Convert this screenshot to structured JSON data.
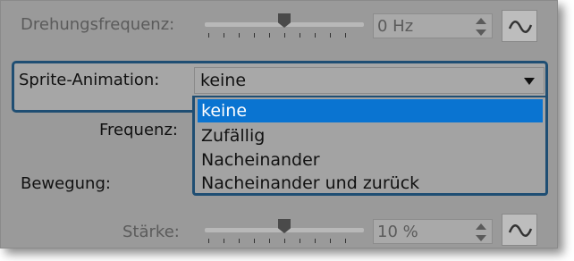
{
  "rotation": {
    "label": "Drehungsfrequenz:",
    "value": "0 Hz",
    "slider_fraction": 0.5
  },
  "sprite_animation": {
    "label": "Sprite-Animation:",
    "selected": "keine",
    "options": [
      "keine",
      "Zufällig",
      "Nacheinander",
      "Nacheinander und zurück"
    ]
  },
  "frequency": {
    "label": "Frequenz:"
  },
  "movement": {
    "label": "Bewegung:"
  },
  "strength": {
    "label": "Stärke:",
    "value": "10 %",
    "slider_fraction": 0.5
  },
  "colors": {
    "panel": "#9a9a9a",
    "focus_border": "#1f4e73",
    "selection": "#0a74d1"
  }
}
